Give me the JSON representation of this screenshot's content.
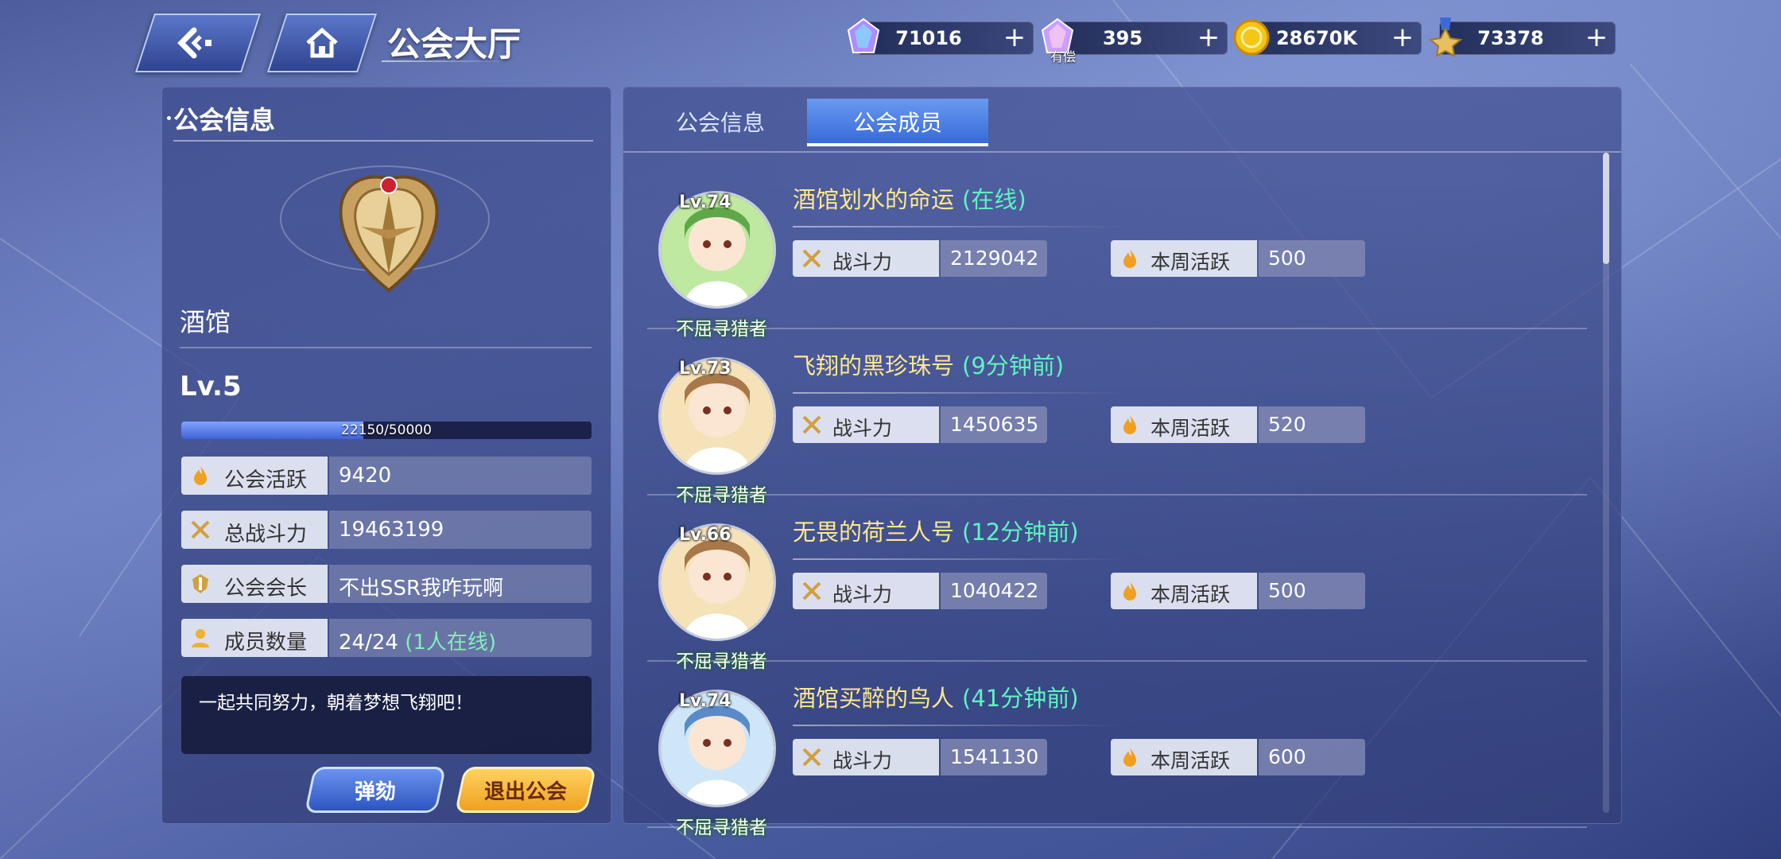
{
  "header": {
    "title": "公会大厅",
    "back_icon": "back-arrow-icon",
    "home_icon": "home-icon"
  },
  "resources": [
    {
      "name": "crystal",
      "value": "71016",
      "icon": "crystal-icon",
      "color": "#b08cff"
    },
    {
      "name": "paid-crystal",
      "value": "395",
      "icon": "paid-crystal-icon",
      "sub": "有偿",
      "color": "#c9a0ff"
    },
    {
      "name": "gold",
      "value": "28670K",
      "icon": "gold-coin-icon",
      "color": "#f5c518"
    },
    {
      "name": "medal",
      "value": "73378",
      "icon": "medal-icon",
      "color": "#e8c060"
    }
  ],
  "left": {
    "title": "公会信息",
    "guild_name": "酒馆",
    "level": "Lv.5",
    "exp_text": "22150/50000",
    "exp_fraction": 0.443,
    "rows": [
      {
        "label": "公会活跃",
        "value": "9420",
        "icon": "flame-icon"
      },
      {
        "label": "总战斗力",
        "value": "19463199",
        "icon": "crossed-swords-icon"
      },
      {
        "label": "公会会长",
        "value": "不出SSR我咋玩啊",
        "icon": "guild-crest-icon"
      },
      {
        "label": "成员数量",
        "value": "24/24",
        "note": "(1人在线)",
        "icon": "person-icon"
      }
    ],
    "motto": "一起共同努力，朝着梦想飞翔吧！",
    "impeach_label": "弹劾",
    "leave_label": "退出公会"
  },
  "tabs": [
    {
      "label": "公会信息",
      "active": false
    },
    {
      "label": "公会成员",
      "active": true
    }
  ],
  "members": [
    {
      "level": "Lv.74",
      "name": "酒馆划水的命运",
      "status": "(在线)",
      "title": "不屈寻猎者",
      "power_label": "战斗力",
      "power": "2129042",
      "active_label": "本周活跃",
      "active": "500"
    },
    {
      "level": "Lv.73",
      "name": "飞翔的黑珍珠号",
      "status": "(9分钟前)",
      "title": "不屈寻猎者",
      "power_label": "战斗力",
      "power": "1450635",
      "active_label": "本周活跃",
      "active": "520"
    },
    {
      "level": "Lv.66",
      "name": "无畏的荷兰人号",
      "status": "(12分钟前)",
      "title": "不屈寻猎者",
      "power_label": "战斗力",
      "power": "1040422",
      "active_label": "本周活跃",
      "active": "500"
    },
    {
      "level": "Lv.74",
      "name": "酒馆买醉的鸟人",
      "status": "(41分钟前)",
      "title": "不屈寻猎者",
      "power_label": "战斗力",
      "power": "1541130",
      "active_label": "本周活跃",
      "active": "600"
    }
  ]
}
